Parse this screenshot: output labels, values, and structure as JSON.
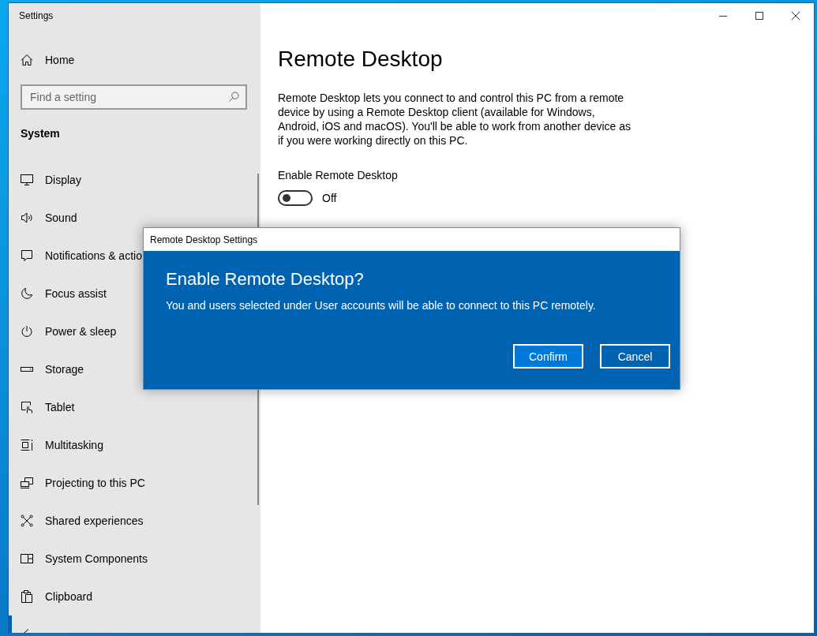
{
  "window": {
    "title": "Settings"
  },
  "sidebar": {
    "home": "Home",
    "search": {
      "placeholder": "Find a setting"
    },
    "section": "System",
    "items": [
      {
        "label": "Display",
        "selected": false
      },
      {
        "label": "Sound",
        "selected": false
      },
      {
        "label": "Notifications & actio",
        "selected": false
      },
      {
        "label": "Focus assist",
        "selected": false
      },
      {
        "label": "Power & sleep",
        "selected": false
      },
      {
        "label": "Storage",
        "selected": false
      },
      {
        "label": "Tablet",
        "selected": false
      },
      {
        "label": "Multitasking",
        "selected": false
      },
      {
        "label": "Projecting to this PC",
        "selected": false
      },
      {
        "label": "Shared experiences",
        "selected": false
      },
      {
        "label": "System Components",
        "selected": false
      },
      {
        "label": "Clipboard",
        "selected": false
      },
      {
        "selected": true
      }
    ]
  },
  "page": {
    "title": "Remote Desktop",
    "description": "Remote Desktop lets you connect to and control this PC from a remote device by using a Remote Desktop client (available for Windows, Android, iOS and macOS). You'll be able to work from another device as if you were working directly on this PC.",
    "setting": {
      "label": "Enable Remote Desktop",
      "on": false,
      "state_text": "Off"
    }
  },
  "dialog": {
    "title": "Remote Desktop Settings",
    "heading": "Enable Remote Desktop?",
    "message": "You and users selected under User accounts will be able to connect to this PC remotely.",
    "buttons": [
      {
        "label": "Confirm",
        "kind": "primary"
      },
      {
        "label": "Cancel",
        "kind": "secondary"
      }
    ]
  }
}
